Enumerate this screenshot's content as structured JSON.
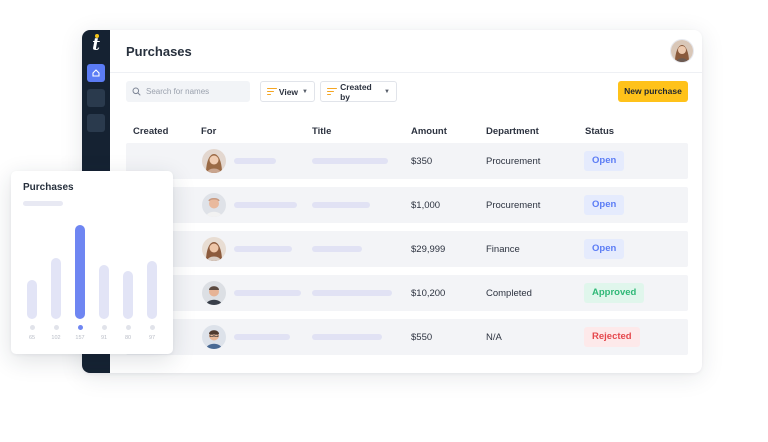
{
  "page": {
    "title": "Purchases",
    "search_placeholder": "Search for names",
    "filters": [
      {
        "label": "View",
        "icon": "filter-lines-icon"
      },
      {
        "label": "Created by",
        "icon": "filter-lines-icon"
      }
    ],
    "new_button": "New purchase"
  },
  "table": {
    "columns": [
      "Created",
      "For",
      "Title",
      "Amount",
      "Department",
      "Status"
    ],
    "rows": [
      {
        "amount": "$350",
        "department": "Procurement",
        "status": "Open"
      },
      {
        "amount": "$1,000",
        "department": "Procurement",
        "status": "Open"
      },
      {
        "amount": "$29,999",
        "department": "Finance",
        "status": "Open"
      },
      {
        "amount": "$10,200",
        "department": "Completed",
        "status": "Approved"
      },
      {
        "amount": "$550",
        "department": "N/A",
        "status": "Rejected"
      }
    ]
  },
  "card": {
    "title": "Purchases",
    "chart_data": {
      "type": "bar",
      "categories": [
        "65",
        "102",
        "157",
        "91",
        "80",
        "97"
      ],
      "values": [
        65,
        102,
        157,
        91,
        80,
        97
      ],
      "highlighted_index": 2,
      "title": "Purchases",
      "xlabel": "",
      "ylabel": ""
    }
  },
  "colors": {
    "sidebar": "#152232",
    "accent_yellow": "#ffc21a",
    "bar_highlight": "#6f86f2",
    "status_open_bg": "#e5ebfd",
    "status_open_text": "#5b7cf5",
    "status_approved_bg": "#e0f6ec",
    "status_approved_text": "#2fb877",
    "status_rejected_bg": "#fde9ea",
    "status_rejected_text": "#e5484d"
  }
}
